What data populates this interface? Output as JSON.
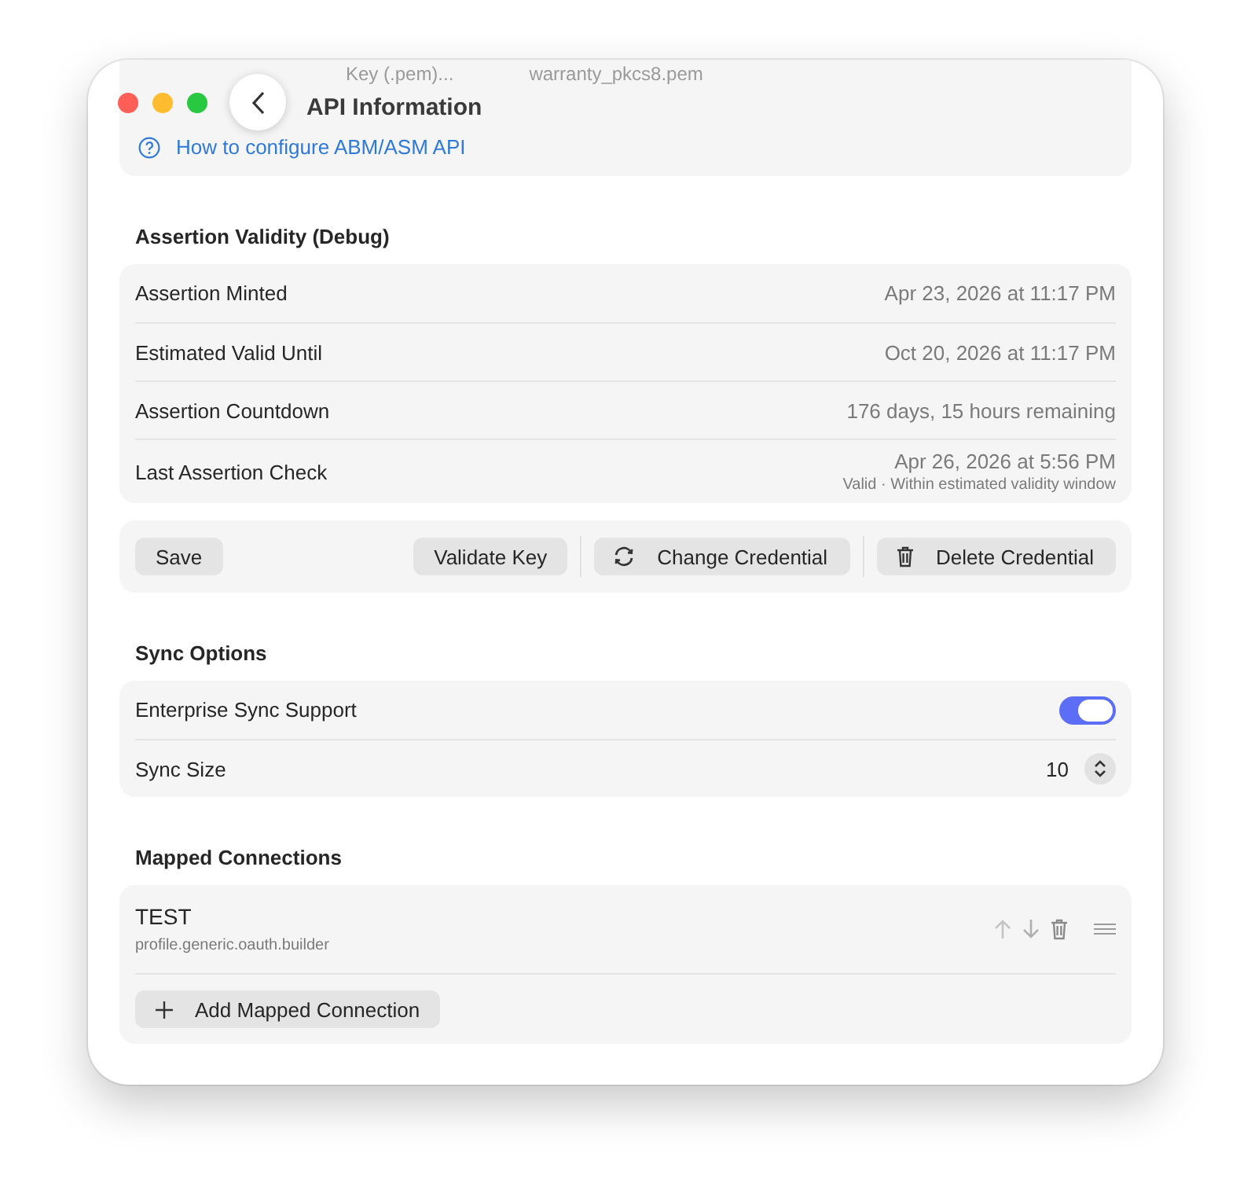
{
  "window": {
    "title": "API Information"
  },
  "key_file": {
    "button": "Key (.pem)...",
    "filename": "warranty_pkcs8.pem"
  },
  "help_link": "How to configure ABM/ASM API",
  "assertion": {
    "heading": "Assertion Validity (Debug)",
    "rows": [
      {
        "label": "Assertion Minted",
        "value": "Apr 23, 2026 at 11:17 PM"
      },
      {
        "label": "Estimated Valid Until",
        "value": "Oct 20, 2026 at 11:17 PM"
      },
      {
        "label": "Assertion Countdown",
        "value": "176 days, 15 hours remaining"
      },
      {
        "label": "Last Assertion Check",
        "value": "Apr 26, 2026 at 5:56 PM",
        "note": "Valid · Within estimated validity window"
      }
    ]
  },
  "actions": [
    {
      "label": "Save",
      "kind": "plain"
    },
    {
      "label": "Validate Key",
      "kind": "plain"
    },
    {
      "label": "Change Credential",
      "kind": "refresh"
    },
    {
      "label": "Delete Credential",
      "kind": "trash"
    }
  ],
  "sync": {
    "heading": "Sync Options",
    "rows": [
      {
        "kind": "toggle",
        "label": "Enterprise Sync Support",
        "on": true
      },
      {
        "kind": "stepper",
        "label": "Sync Size",
        "value": "10"
      }
    ]
  },
  "mapped": {
    "heading": "Mapped Connections",
    "items": [
      {
        "name": "TEST",
        "profile": "profile.generic.oauth.builder"
      }
    ],
    "add_button": "Add Mapped Connection"
  }
}
